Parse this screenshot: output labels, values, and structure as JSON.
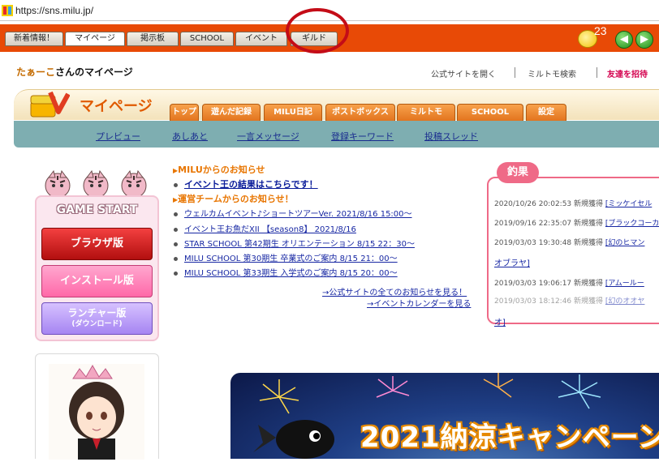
{
  "browser": {
    "url": "https://sns.milu.jp/"
  },
  "menubar": {
    "tabs": [
      "新着情報！",
      "マイページ",
      "掲示板",
      "SCHOOL",
      "イベント",
      "ギルド"
    ],
    "active_tab": "マイページ",
    "notification_count": "23"
  },
  "header": {
    "user_name": "たぁーこ",
    "title_suffix": "さんのマイページ",
    "links": [
      "公式サイトを開く",
      "ミルトモ検索",
      "友達を招待"
    ]
  },
  "mypage": {
    "title": "マイページ",
    "tabs": [
      "トップ",
      "遊んだ記録",
      "MILU日記",
      "ポストボックス",
      "ミルトモ",
      "SCHOOL",
      "設定"
    ]
  },
  "subnav": [
    "プレビュー",
    "あしあと",
    "一言メッセージ",
    "登録キーワード",
    "投稿スレッド"
  ],
  "game": {
    "title": "GAME START",
    "browser_btn": "ブラウザ版",
    "install_btn": "インストール版",
    "launcher_btn": "ランチャー版",
    "launcher_sub": "(ダウンロード)"
  },
  "news": {
    "milu_heading": "MILUからのお知らせ",
    "milu_items": [
      "イベント王の結果はこちらです！"
    ],
    "ops_heading": "運営チームからのお知らせ！",
    "ops_items": [
      "ウェルカムイベント♪ショートツアーVer. 2021/8/16 15:00～",
      "イベント王お魚だXII 【season8】 2021/8/16",
      "STAR SCHOOL 第42期生 オリエンテーション 8/15 22：30～",
      "MILU SCHOOL 第30期生 卒業式のご案内 8/15 21：00～",
      "MILU SCHOOL 第33期生 入学式のご案内 8/15 20：00～"
    ],
    "more_news": "→公式サイトの全てのお知らせを見る！",
    "calendar": "→イベントカレンダーを見る"
  },
  "fishing": {
    "title": "釣果",
    "rows": [
      {
        "date": "2020/10/26 20:02:53",
        "label": "新規獲得",
        "item": "[ミッケイセル"
      },
      {
        "date": "2019/09/16 22:35:07",
        "label": "新規獲得",
        "item": "[ブラックコーカ"
      },
      {
        "date": "2019/03/03 19:30:48",
        "label": "新規獲得",
        "item": "[幻のヒマン"
      },
      {
        "date": "",
        "label": "",
        "item": "オブラヤ]"
      },
      {
        "date": "2019/03/03 19:06:17",
        "label": "新規獲得",
        "item": "[アムールー"
      },
      {
        "date": "2019/03/03 18:12:46",
        "label": "新規獲得",
        "item": "[幻のオオヤ"
      },
      {
        "date": "",
        "label": "",
        "item": "オ]"
      }
    ]
  },
  "campaign": {
    "title": "2021納涼キャンペーン"
  },
  "colors": {
    "menubar": "#e84a06",
    "accent_orange": "#e87500",
    "subnav": "#7eaeb1",
    "fishing": "#ef6a87"
  }
}
